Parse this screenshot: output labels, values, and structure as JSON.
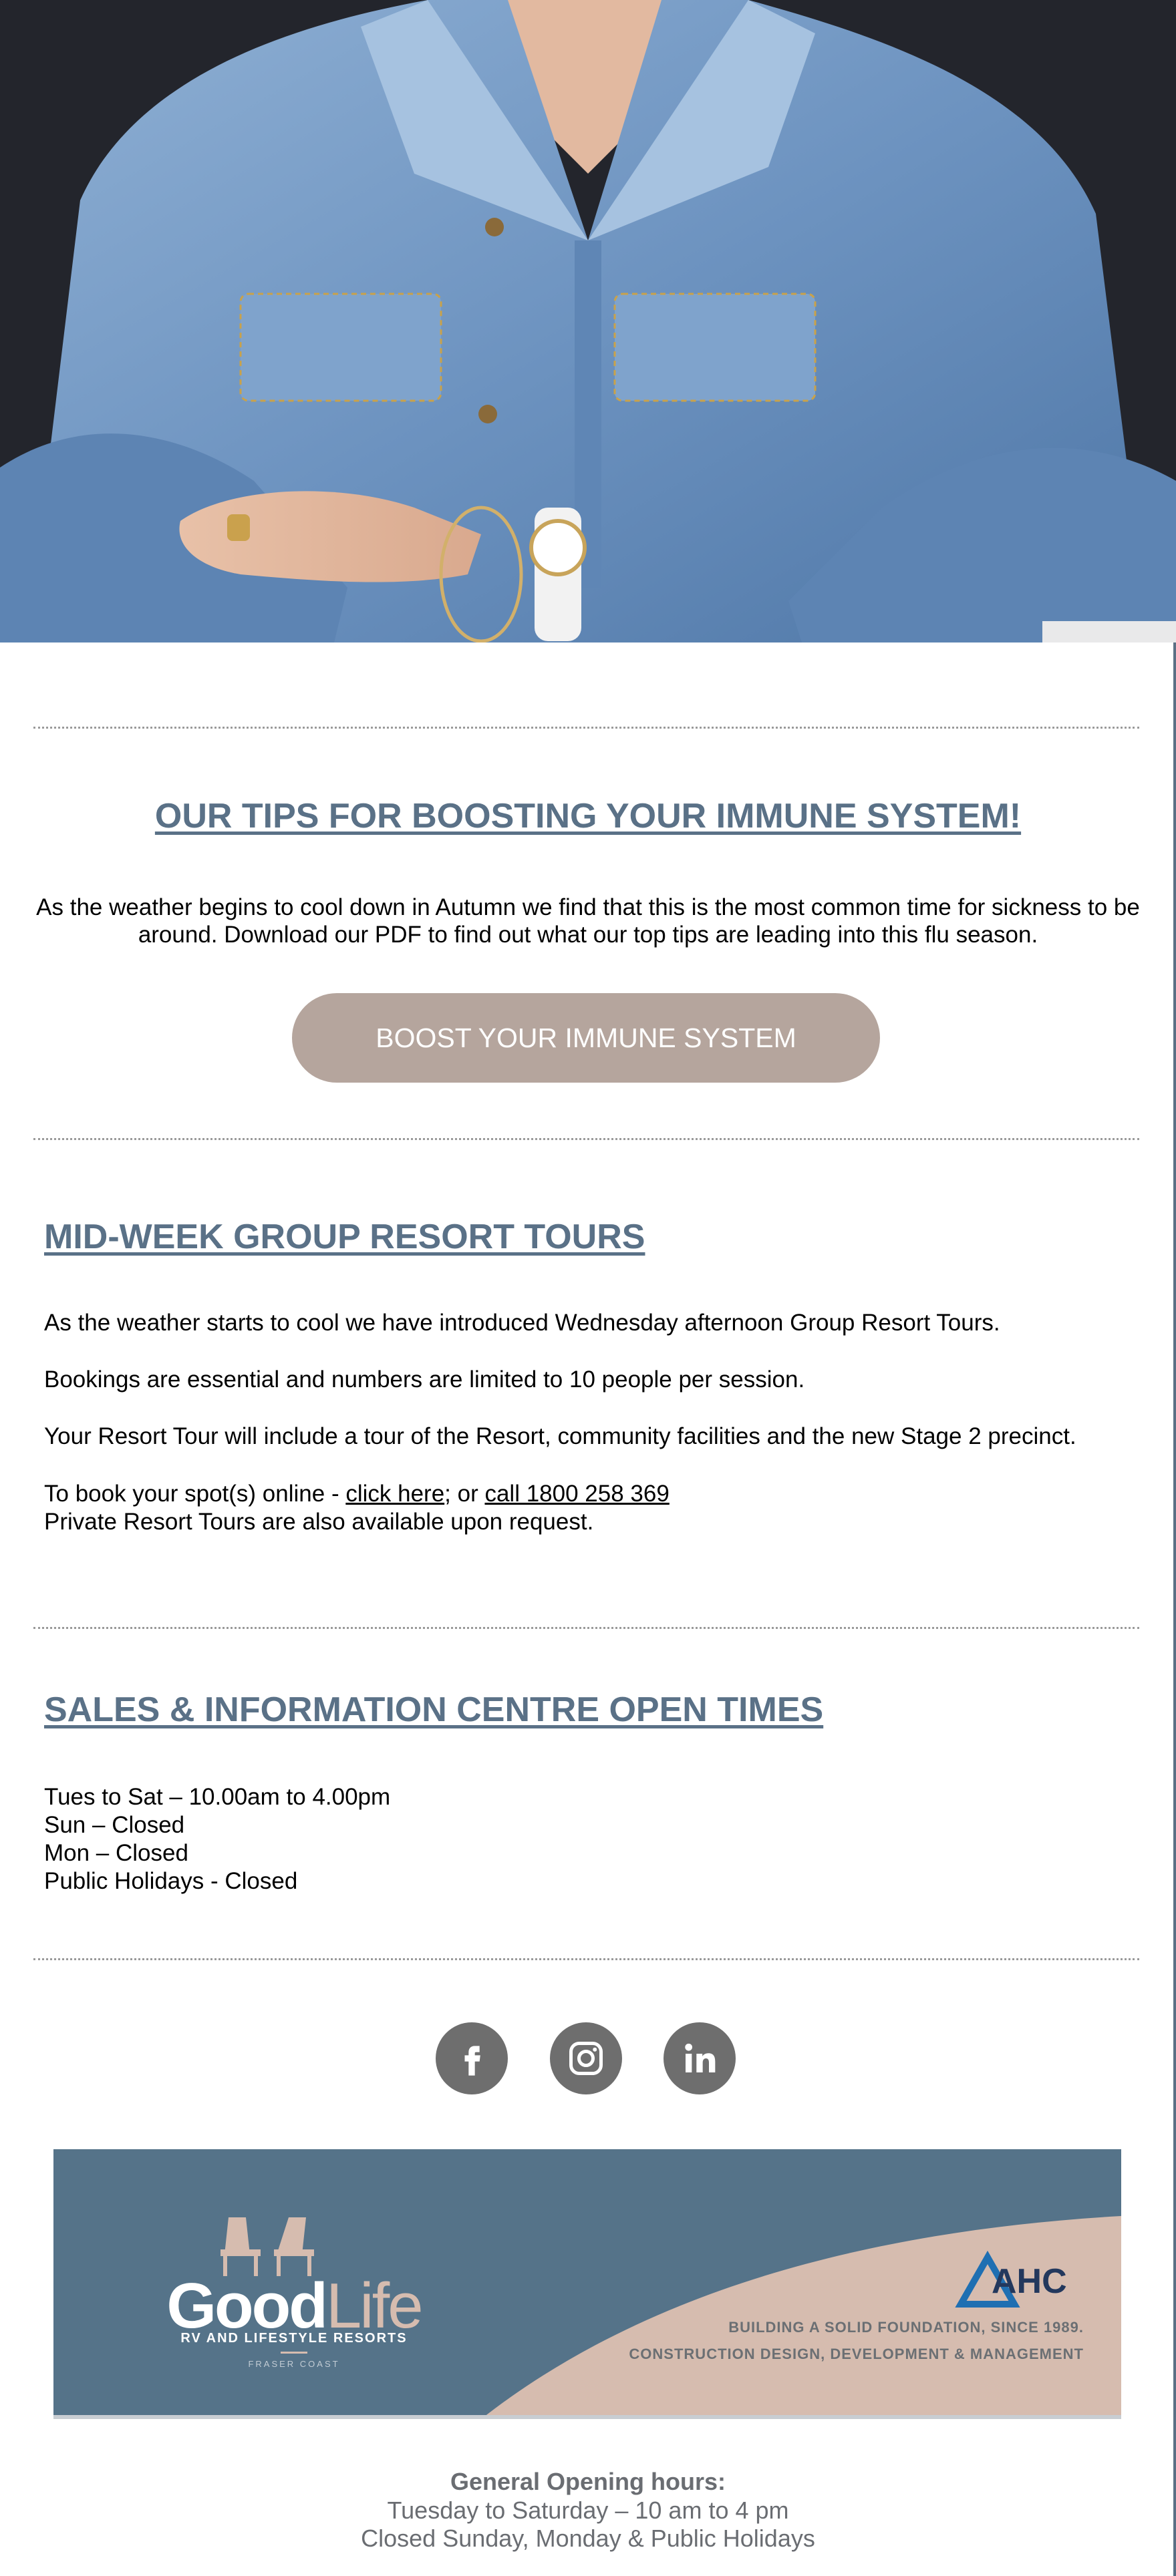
{
  "colors": {
    "heading": "#5a7187",
    "cta_bg": "#b5a59d",
    "banner_blue": "#557389",
    "banner_tan": "#d6bcaf",
    "social_bg": "#6e6e6e"
  },
  "hero": {
    "alt": ""
  },
  "immune": {
    "title": "OUR TIPS FOR BOOSTING YOUR IMMUNE SYSTEM!",
    "body": "As the weather begins to cool down in Autumn we find that this is the most common time for sickness to be around. Download our PDF to find out what our top tips are leading into this flu season.",
    "cta_label": "BOOST YOUR IMMUNE SYSTEM"
  },
  "tours": {
    "title": "MID-WEEK GROUP RESORT TOURS",
    "line1": "As the weather starts to cool we have introduced Wednesday afternoon Group Resort Tours.",
    "line2": "Bookings are essential and numbers are limited to 10 people per session.",
    "line3": "Your Resort Tour will include a tour of the Resort, community facilities and the new Stage 2 precinct.",
    "book_prefix": "To book your spot(s) online - ",
    "click_here": "click here",
    "book_mid": "; or ",
    "call_link": "call 1800 258 369",
    "line5": "Private Resort Tours are also available upon request."
  },
  "times": {
    "title": "SALES & INFORMATION CENTRE OPEN TIMES",
    "rows": [
      "Tues to Sat – 10.00am to 4.00pm",
      "Sun – Closed",
      "Mon – Closed",
      "Public Holidays - Closed"
    ]
  },
  "social": {
    "items": [
      "facebook-icon",
      "instagram-icon",
      "linkedin-icon"
    ]
  },
  "banner": {
    "brand_good": "Good",
    "brand_life": "Life",
    "brand_sub": "RV AND LIFESTYLE RESORTS",
    "brand_location": "FRASER COAST",
    "partner": "AHC",
    "tagline1": "BUILDING A SOLID FOUNDATION, SINCE 1989.",
    "tagline2": "CONSTRUCTION DESIGN, DEVELOPMENT & MANAGEMENT"
  },
  "footer": {
    "heading": "General Opening hours:",
    "line1": "Tuesday to Saturday – 10 am to 4 pm",
    "line2": "Closed Sunday, Monday & Public Holidays"
  }
}
